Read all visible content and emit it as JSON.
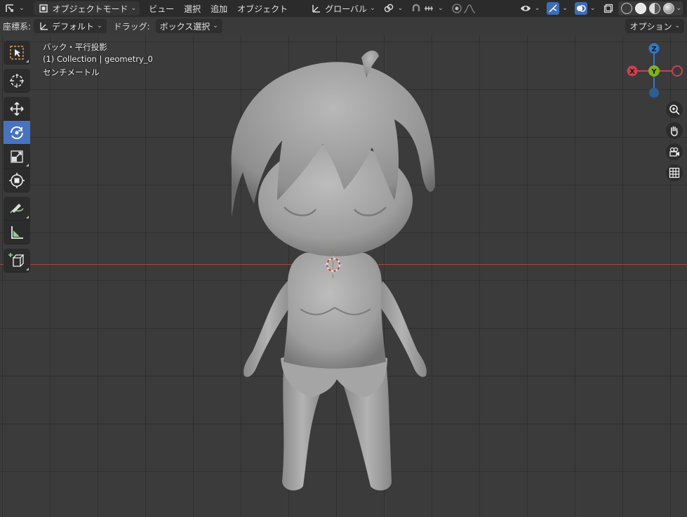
{
  "header": {
    "mode": "オブジェクトモード",
    "menus": [
      "ビュー",
      "選択",
      "追加",
      "オブジェクト"
    ],
    "transform_orientation": "グローバル",
    "icons": [
      "editor-type-icon",
      "object-mode-icon",
      "orientation-icon",
      "pivot-icon",
      "snap-icon",
      "proportional-icon",
      "visibility-icon",
      "gizmo-icon",
      "overlay-icon",
      "xray-icon",
      "shading-icons"
    ]
  },
  "tool_settings": {
    "coord_label": "座標系:",
    "coord_value": "デフォルト",
    "drag_label": "ドラッグ:",
    "drag_value": "ボックス選択",
    "options_label": "オプション"
  },
  "viewport": {
    "view_name": "バック・平行投影",
    "collection_info": "(1) Collection | geometry_0",
    "units": "センチメートル"
  },
  "gizmo": {
    "x_label": "X",
    "y_label": "Y",
    "z_label": "Z",
    "colors": {
      "x": "#c8424f",
      "y": "#7fb11e",
      "z": "#2f79c8"
    }
  },
  "tools": [
    "select-box",
    "cursor",
    "move",
    "rotate",
    "scale",
    "transform",
    "annotate",
    "measure",
    "add-cube"
  ],
  "nav_buttons": [
    "zoom",
    "pan",
    "camera",
    "ortho-grid"
  ]
}
